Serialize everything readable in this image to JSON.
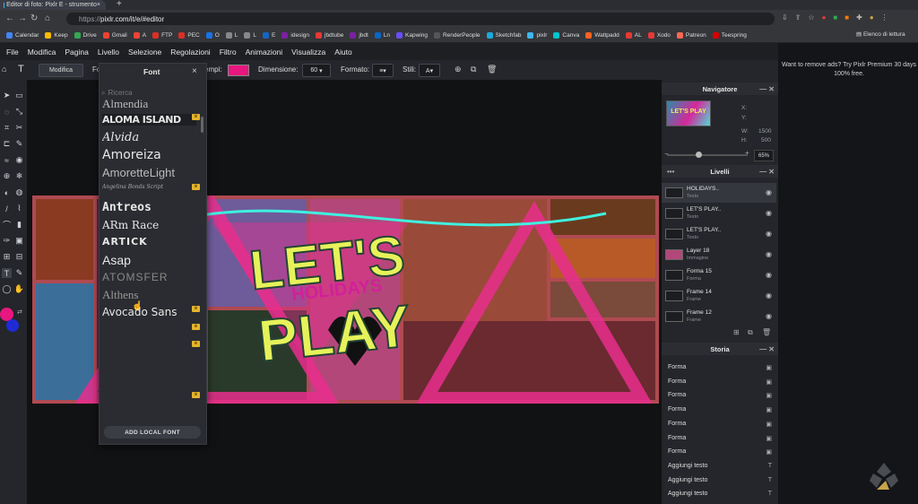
{
  "browser": {
    "tab_title": "Editor di foto: Pixlr E - strumento",
    "url_host": "https://",
    "url_path": "pixlr.com/it/e/#editor",
    "bookmarks": [
      {
        "label": "Calendar",
        "color": "#4285f4"
      },
      {
        "label": "Keep",
        "color": "#fbbc04"
      },
      {
        "label": "Drive",
        "color": "#34a853"
      },
      {
        "label": "Gmail",
        "color": "#ea4335"
      },
      {
        "label": "A",
        "color": "#ea4335"
      },
      {
        "label": "FTP",
        "color": "#d93025"
      },
      {
        "label": "PEC",
        "color": "#d93025"
      },
      {
        "label": "O",
        "color": "#1a73e8"
      },
      {
        "label": "L",
        "color": "#888888"
      },
      {
        "label": "L",
        "color": "#888888"
      },
      {
        "label": "E",
        "color": "#1565c0"
      },
      {
        "label": "idesign",
        "color": "#7b1fa2"
      },
      {
        "label": "jbdtube",
        "color": "#e53935"
      },
      {
        "label": "jbdt",
        "color": "#7b1fa2"
      },
      {
        "label": "Ln",
        "color": "#0a66c2"
      },
      {
        "label": "Kapwing",
        "color": "#6a4cff"
      },
      {
        "label": "RenderPeople",
        "color": "#555555"
      },
      {
        "label": "Sketchfab",
        "color": "#1caad9"
      },
      {
        "label": "pixlr",
        "color": "#3fb7f0"
      },
      {
        "label": "Canva",
        "color": "#00c4cc"
      },
      {
        "label": "Wattpadd",
        "color": "#ff6122"
      },
      {
        "label": "AL",
        "color": "#e53935"
      },
      {
        "label": "Xodo",
        "color": "#e53935"
      },
      {
        "label": "Patreon",
        "color": "#f96854"
      },
      {
        "label": "Teespring",
        "color": "#d50000"
      }
    ],
    "reading_list": "Elenco di lettura"
  },
  "menu": [
    "File",
    "Modifica",
    "Pagina",
    "Livello",
    "Selezione",
    "Regolazioni",
    "Filtro",
    "Animazioni",
    "Visualizza",
    "Aiuto"
  ],
  "options": {
    "modifica_btn": "Modifica",
    "font_label_short": "Fo",
    "fill_label": "empi:",
    "fill_color": "#e8177f",
    "size_label": "Dimensione:",
    "size_value": "60",
    "format_label": "Formato:",
    "style_label": "Stili:"
  },
  "font_panel": {
    "title": "Font",
    "search_placeholder": "Ricerca",
    "fonts": [
      {
        "name": "Almendia",
        "premium": false
      },
      {
        "name": "ALOMA ISLAND",
        "premium": true
      },
      {
        "name": "Alvida",
        "premium": false
      },
      {
        "name": "Amoreiza",
        "premium": false
      },
      {
        "name": "AmoretteLight",
        "premium": false
      },
      {
        "name": "Angelina Bonds Script",
        "premium": true
      },
      {
        "name": "Antreos",
        "premium": false
      },
      {
        "name": "ARm Race",
        "premium": false
      },
      {
        "name": "ARTICK",
        "premium": false
      },
      {
        "name": "Asap",
        "premium": false
      },
      {
        "name": "ATOMSFER",
        "premium": false
      },
      {
        "name": "Althens",
        "premium": false
      },
      {
        "name": "Avocado Sans",
        "premium": true
      }
    ],
    "add_local_font": "ADD LOCAL FONT"
  },
  "canvas": {
    "title_line1": "LET'S",
    "subtitle": "HOLIDAYS",
    "title_line2": "PLAY",
    "thumb_text": "LET'S PLAY"
  },
  "navigator": {
    "title": "Navigatore",
    "x_label": "X:",
    "y_label": "Y:",
    "w_label": "W:",
    "w_value": "1500",
    "h_label": "H:",
    "h_value": "500",
    "zoom": "65%"
  },
  "layers": {
    "title": "Livelli",
    "items": [
      {
        "name": "HOLIDAYS..",
        "type": "Testo"
      },
      {
        "name": "LET'S PLAY..",
        "type": "Testo"
      },
      {
        "name": "LET'S PLAY..",
        "type": "Testo"
      },
      {
        "name": "Layer 18",
        "type": "Immagine"
      },
      {
        "name": "Forma 15",
        "type": "Forma"
      },
      {
        "name": "Frame 14",
        "type": "Frame"
      },
      {
        "name": "Frame 12",
        "type": "Frame"
      }
    ]
  },
  "history": {
    "title": "Storia",
    "items": [
      "Forma",
      "Forma",
      "Forma",
      "Forma",
      "Forma",
      "Forma",
      "Forma",
      "Aggiungi testo",
      "Aggiungi testo",
      "Aggiungi testo"
    ]
  },
  "ad": {
    "text": "Want to remove ads? Try Pixlr Premium 30 days 100% free."
  }
}
